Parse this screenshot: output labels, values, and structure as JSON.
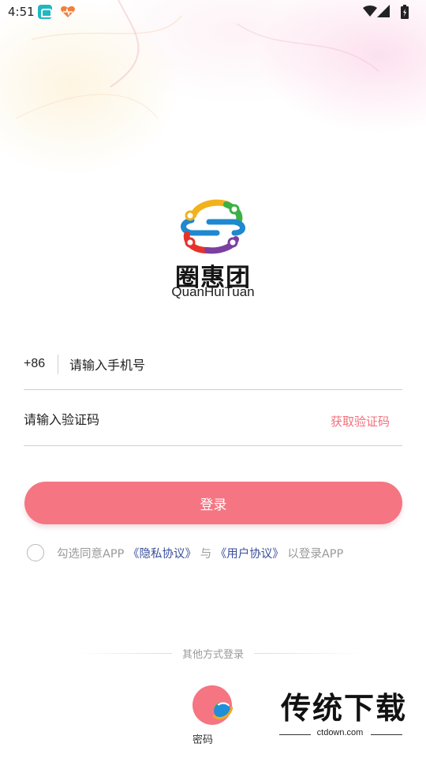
{
  "status_bar": {
    "time": "4:51",
    "icons": [
      "car-app-icon",
      "health-app-icon",
      "wifi-icon",
      "signal-icon",
      "battery-icon"
    ]
  },
  "brand": {
    "name": "圈惠团",
    "subtitle": "QuanHuiTuan"
  },
  "form": {
    "country_code": "+86",
    "phone_placeholder": "请输入手机号",
    "code_placeholder": "请输入验证码",
    "get_code_label": "获取验证码",
    "login_label": "登录"
  },
  "agreement": {
    "prefix": "勾选同意APP",
    "privacy_link": "《隐私协议》",
    "conjunction": "与",
    "user_link": "《用户协议》",
    "suffix": "以登录APP"
  },
  "other_login": {
    "label": "其他方式登录",
    "password_login_label": "密码"
  },
  "watermark": {
    "text": "传统下载",
    "url": "ctdown.com"
  },
  "colors": {
    "accent": "#f57582",
    "link": "#3a4f9a",
    "hint": "#9a9a9a"
  }
}
